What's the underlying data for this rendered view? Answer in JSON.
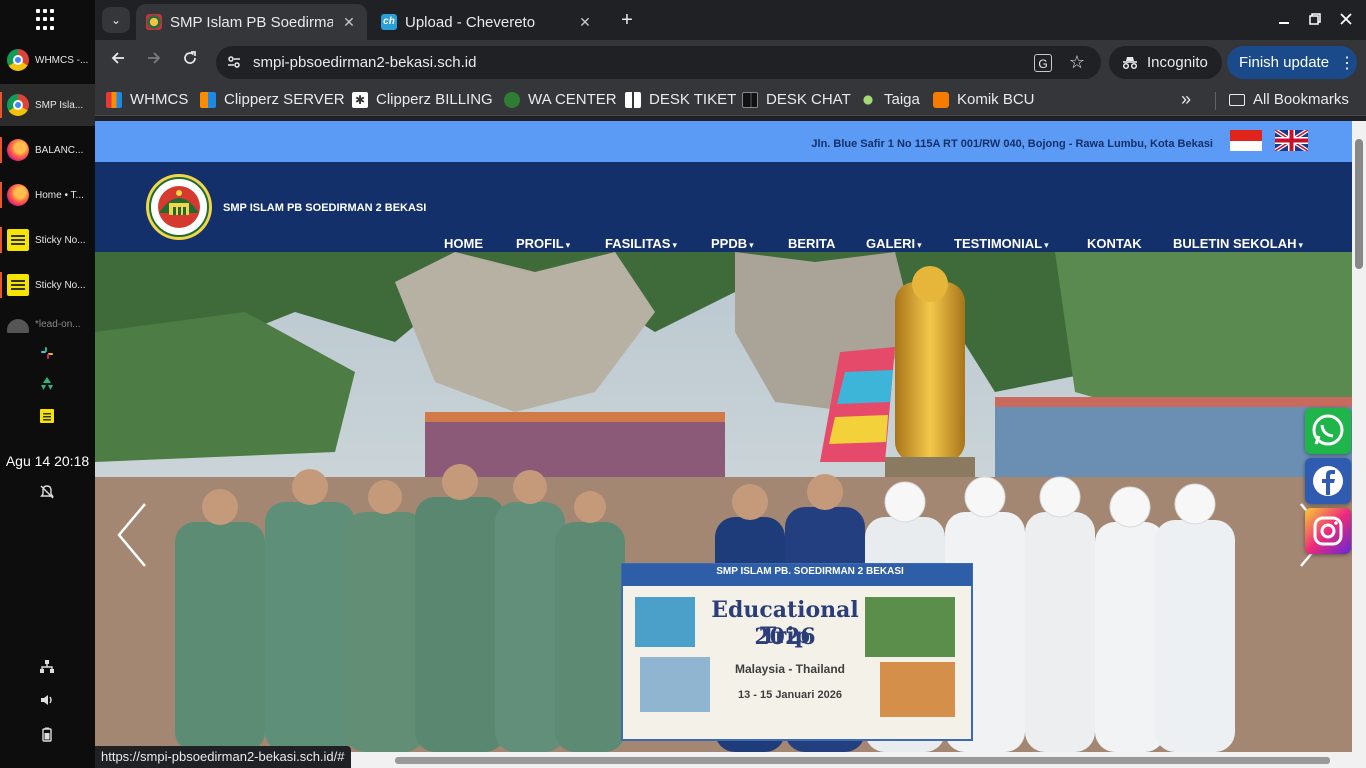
{
  "taskbar": {
    "items": [
      {
        "label": "WHMCS -..."
      },
      {
        "label": "SMP Isla..."
      },
      {
        "label": "BALANC..."
      },
      {
        "label": "Home • T..."
      },
      {
        "label": "Sticky No..."
      },
      {
        "label": "Sticky No..."
      },
      {
        "label": "*lead-on..."
      }
    ],
    "clock": "Agu 14  20:18"
  },
  "browser": {
    "tabs": [
      {
        "title": "SMP Islam PB Soedirman 2 Bekasi"
      },
      {
        "title": "Upload - Chevereto"
      }
    ],
    "url": "smpi-pbsoedirman2-bekasi.sch.id",
    "incognito_label": "Incognito",
    "finish_update_label": "Finish update",
    "bookmarks": [
      {
        "label": "WHMCS"
      },
      {
        "label": "Clipperz SERVER"
      },
      {
        "label": "Clipperz BILLING"
      },
      {
        "label": "WA CENTER"
      },
      {
        "label": "DESK TIKET"
      },
      {
        "label": "DESK CHAT"
      },
      {
        "label": "Taiga"
      },
      {
        "label": "Komik BCU"
      }
    ],
    "all_bookmarks_label": "All Bookmarks",
    "status_url": "https://smpi-pbsoedirman2-bekasi.sch.id/#"
  },
  "site": {
    "address": "Jln. Blue Safir 1 No 115A RT 001/RW 040, Bojong - Rawa Lumbu, Kota Bekasi",
    "school_name": "SMP ISLAM PB SOEDIRMAN 2 BEKASI",
    "nav": [
      {
        "label": "HOME"
      },
      {
        "label": "PROFIL"
      },
      {
        "label": "FASILITAS"
      },
      {
        "label": "PPDB"
      },
      {
        "label": "BERITA"
      },
      {
        "label": "GALERI"
      },
      {
        "label": "TESTIMONIAL"
      },
      {
        "label": "KONTAK"
      },
      {
        "label": "BULETIN SEKOLAH"
      }
    ],
    "banner": {
      "header": "SMP ISLAM PB. SOEDIRMAN 2 BEKASI",
      "title_line1": "Educational Trip",
      "title_line2": "2026",
      "destination": "Malaysia - Thailand",
      "dates": "13 - 15 Januari 2026"
    }
  },
  "colors": {
    "topbar": "#5b9bf5",
    "header": "#13306b",
    "update_button": "#1a4a8a"
  }
}
